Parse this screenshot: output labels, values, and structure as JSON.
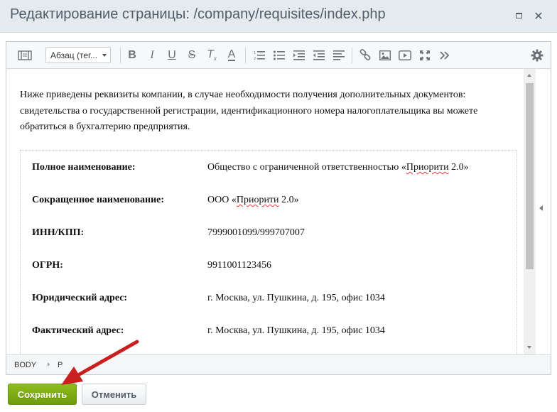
{
  "window": {
    "title": "Редактирование страницы: /company/requisites/index.php"
  },
  "toolbar": {
    "block_format": "Абзац (тег...",
    "icons": [
      "source-view-icon",
      "bold-icon",
      "italic-icon",
      "underline-icon",
      "strikethrough-icon",
      "remove-format-icon",
      "font-color-icon",
      "ordered-list-icon",
      "unordered-list-icon",
      "indent-icon",
      "outdent-icon",
      "align-icon",
      "link-icon",
      "image-icon",
      "video-icon",
      "fullscreen-icon",
      "more-icon",
      "settings-icon"
    ]
  },
  "content": {
    "intro": "Ниже приведены реквизиты компании, в случае необходимости получения дополнительных документов: свидетельства о государственной регистрации, идентификационного номера налогоплательщика вы можете обратиться в бухгалтерию предприятия.",
    "rows": [
      {
        "label": "Полное наименование:",
        "value_pre": "Общество с ограниченной ответственностью «",
        "value_mark": "Приорити",
        "value_post": " 2.0»"
      },
      {
        "label": "Сокращенное наименование:",
        "value_pre": "ООО «",
        "value_mark": "Приорити",
        "value_post": " 2.0»"
      },
      {
        "label": "ИНН/КПП:",
        "value_pre": "7999001099/999707007",
        "value_mark": "",
        "value_post": ""
      },
      {
        "label": "ОГРН:",
        "value_pre": "9911001123456",
        "value_mark": "",
        "value_post": ""
      },
      {
        "label": "Юридический адрес:",
        "value_pre": "г. Москва, ул. Пушкина, д. 195, офис 1034",
        "value_mark": "",
        "value_post": ""
      },
      {
        "label": "Фактический адрес:",
        "value_pre": "г. Москва, ул. Пушкина, д. 195, офис 1034",
        "value_mark": "",
        "value_post": ""
      }
    ]
  },
  "pathbar": {
    "items": [
      "BODY",
      "P"
    ]
  },
  "buttons": {
    "save": "Сохранить",
    "cancel": "Отменить"
  },
  "colors": {
    "save_button": "#7aa816",
    "annotation_arrow": "#c8201f",
    "title_bar": "#e4ebee"
  }
}
